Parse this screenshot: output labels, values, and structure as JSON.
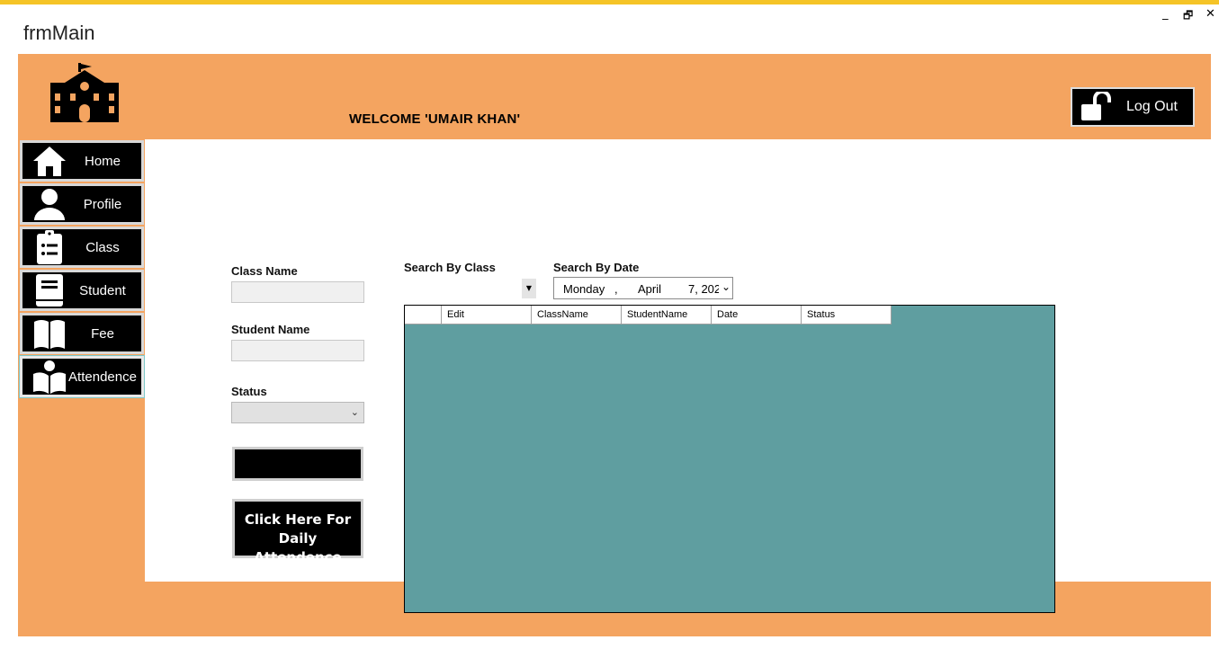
{
  "window": {
    "title": "frmMain",
    "controls": {
      "minimize": "_",
      "restore": "🗗",
      "close": "✕"
    }
  },
  "header": {
    "logo_icon": "school-icon",
    "welcome_text": "WELCOME  'UMAIR KHAN'",
    "logout": {
      "icon": "unlock-icon",
      "label": "Log Out"
    }
  },
  "sidebar": {
    "items": [
      {
        "icon": "home-icon",
        "label": "Home"
      },
      {
        "icon": "user-icon",
        "label": "Profile"
      },
      {
        "icon": "clipboard-icon",
        "label": "Class"
      },
      {
        "icon": "book-icon",
        "label": "Student"
      },
      {
        "icon": "open-book-icon",
        "label": "Fee"
      },
      {
        "icon": "reader-icon",
        "label": "Attendence",
        "active": true
      }
    ]
  },
  "form": {
    "class_name_label": "Class Name",
    "class_name_value": "",
    "student_name_label": "Student Name",
    "student_name_value": "",
    "status_label": "Status",
    "status_value": "",
    "blank_button_label": "",
    "daily_button_label_line1": "Click Here For",
    "daily_button_label_line2": "Daily Attendence"
  },
  "search": {
    "by_class_label": "Search By Class",
    "by_date_label": "Search By Date",
    "date": {
      "weekday": "Monday",
      "sep": ",",
      "month": "April",
      "day_year": "7, 202"
    }
  },
  "grid": {
    "columns": [
      "",
      "Edit",
      "ClassName",
      "StudentName",
      "Date",
      "Status"
    ],
    "rows": []
  },
  "colors": {
    "accent_bar": "#f5c427",
    "frame": "#f4a460",
    "grid_background": "#5f9ea0",
    "button": "#000000"
  }
}
